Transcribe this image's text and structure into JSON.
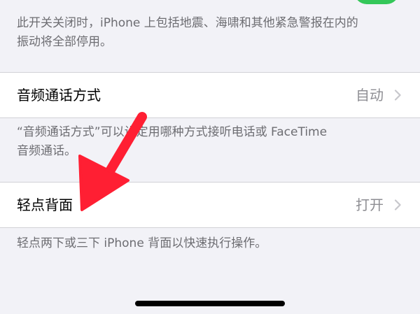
{
  "accent": {
    "toggle_on": "#34c759",
    "arrow": "#ff1f33"
  },
  "emergency_alerts": {
    "footer": "此开关关闭时，iPhone 上包括地震、海啸和其他紧急警报在内的\n振动将全部停用。"
  },
  "audio_call_routing": {
    "title": "音频通话方式",
    "value": "自动",
    "footer": "“音频通话方式”可以设定用哪种方式接听电话或 FaceTime\n音频通话。"
  },
  "back_tap": {
    "title": "轻点背面",
    "value": "打开",
    "footer": "轻点两下或三下 iPhone 背面以快速执行操作。"
  },
  "icons": {
    "chevron": "chevron-right-icon",
    "arrow": "red-annotation-arrow-icon"
  }
}
